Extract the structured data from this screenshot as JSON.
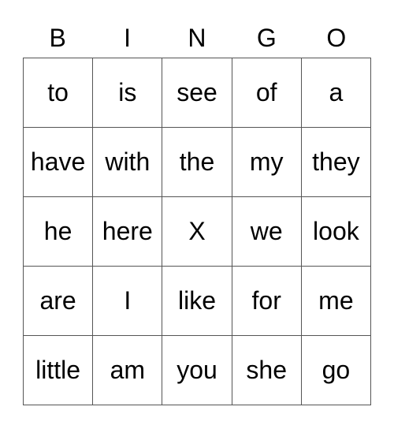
{
  "header": [
    "B",
    "I",
    "N",
    "G",
    "O"
  ],
  "rows": [
    [
      "to",
      "is",
      "see",
      "of",
      "a"
    ],
    [
      "have",
      "with",
      "the",
      "my",
      "they"
    ],
    [
      "he",
      "here",
      "X",
      "we",
      "look"
    ],
    [
      "are",
      "I",
      "like",
      "for",
      "me"
    ],
    [
      "little",
      "am",
      "you",
      "she",
      "go"
    ]
  ]
}
